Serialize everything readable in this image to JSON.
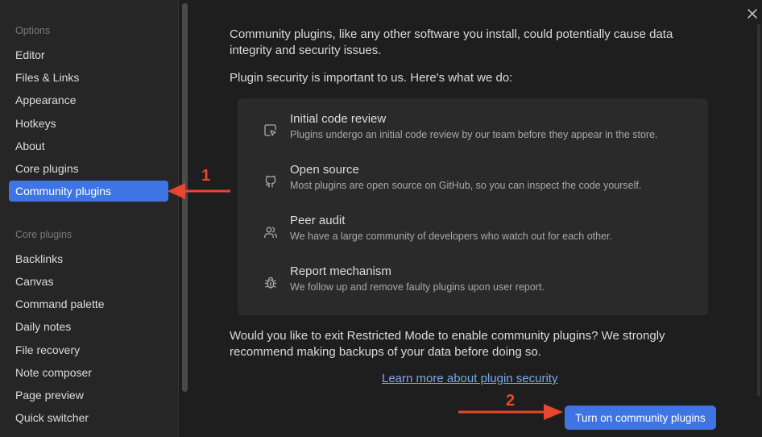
{
  "sidebar": {
    "options_heading": "Options",
    "options_items": [
      {
        "label": "Editor"
      },
      {
        "label": "Files & Links"
      },
      {
        "label": "Appearance"
      },
      {
        "label": "Hotkeys"
      },
      {
        "label": "About"
      },
      {
        "label": "Core plugins"
      },
      {
        "label": "Community plugins",
        "active": true
      }
    ],
    "core_heading": "Core plugins",
    "core_items": [
      {
        "label": "Backlinks"
      },
      {
        "label": "Canvas"
      },
      {
        "label": "Command palette"
      },
      {
        "label": "Daily notes"
      },
      {
        "label": "File recovery"
      },
      {
        "label": "Note composer"
      },
      {
        "label": "Page preview"
      },
      {
        "label": "Quick switcher"
      }
    ]
  },
  "main": {
    "intro": "Community plugins, like any other software you install, could potentially cause data integrity and security issues.",
    "security_heading": "Plugin security is important to us. Here's what we do:",
    "features": [
      {
        "icon": "code-review-icon",
        "title": "Initial code review",
        "desc": "Plugins undergo an initial code review by our team before they appear in the store."
      },
      {
        "icon": "github-icon",
        "title": "Open source",
        "desc": "Most plugins are open source on GitHub, so you can inspect the code yourself."
      },
      {
        "icon": "users-icon",
        "title": "Peer audit",
        "desc": "We have a large community of developers who watch out for each other."
      },
      {
        "icon": "bug-icon",
        "title": "Report mechanism",
        "desc": "We follow up and remove faulty plugins upon user report."
      }
    ],
    "question": "Would you like to exit Restricted Mode to enable community plugins? We strongly recommend making backups of your data before doing so.",
    "learn_more": "Learn more about plugin security",
    "turn_on_button": "Turn on community plugins"
  },
  "annotations": {
    "step1": "1",
    "step2": "2"
  },
  "colors": {
    "accent": "#3f74e5",
    "annotation": "#e8462f",
    "link": "#7fa6e8"
  }
}
